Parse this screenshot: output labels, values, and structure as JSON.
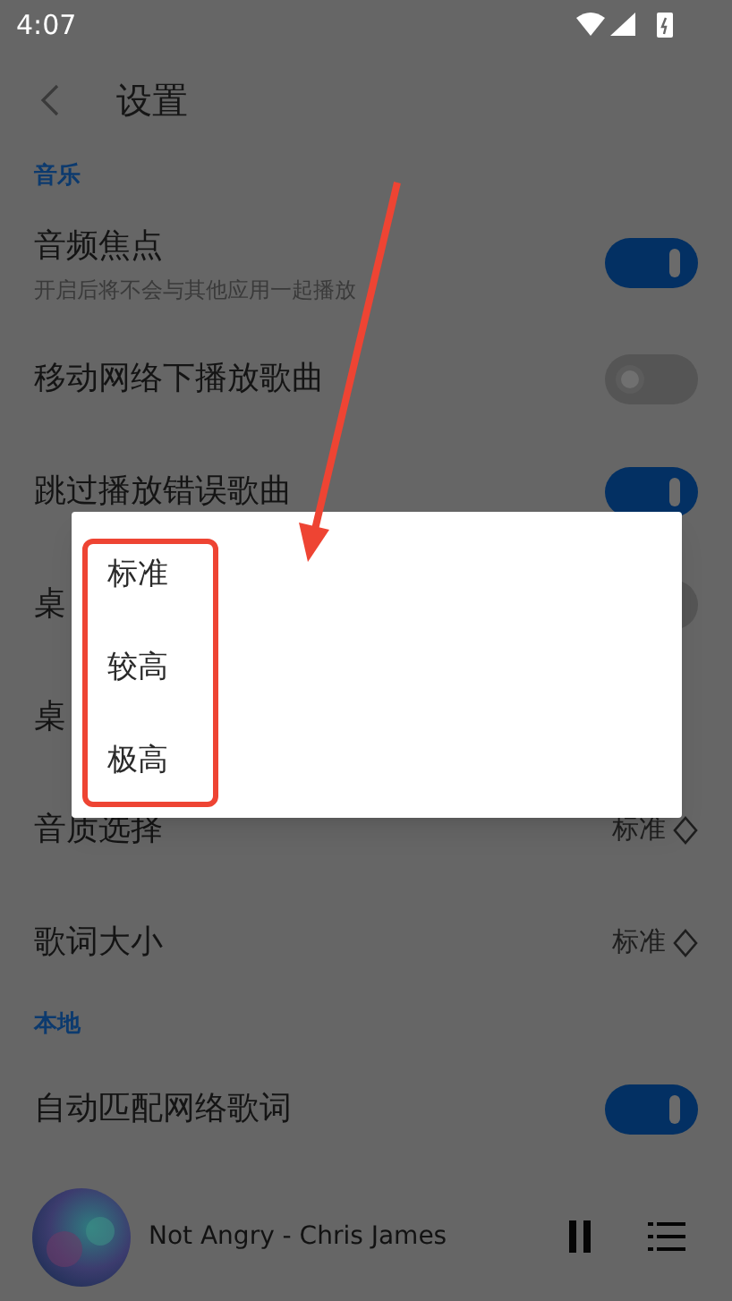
{
  "status_bar": {
    "time": "4:07"
  },
  "header": {
    "title": "设置"
  },
  "sections": [
    {
      "title": "音乐",
      "rows": [
        {
          "kind": "toggle",
          "label": "音频焦点",
          "subtitle": "开启后将不会与其他应用一起播放",
          "on": true
        },
        {
          "kind": "toggle",
          "label": "移动网络下播放歌曲",
          "on": false
        },
        {
          "kind": "toggle",
          "label": "跳过播放错误歌曲",
          "on": true
        },
        {
          "kind": "toggle",
          "label": "桌",
          "on": false
        },
        {
          "kind": "plain",
          "label": "桌"
        },
        {
          "kind": "select",
          "label": "音质选择",
          "value": "标准"
        },
        {
          "kind": "select",
          "label": "歌词大小",
          "value": "标准"
        }
      ]
    },
    {
      "title": "本地",
      "rows": [
        {
          "kind": "toggle",
          "label": "自动匹配网络歌词",
          "on": true
        }
      ]
    }
  ],
  "player": {
    "track": "Not Angry - Chris James"
  },
  "dialog": {
    "options": [
      "标准",
      "较高",
      "极高"
    ]
  }
}
